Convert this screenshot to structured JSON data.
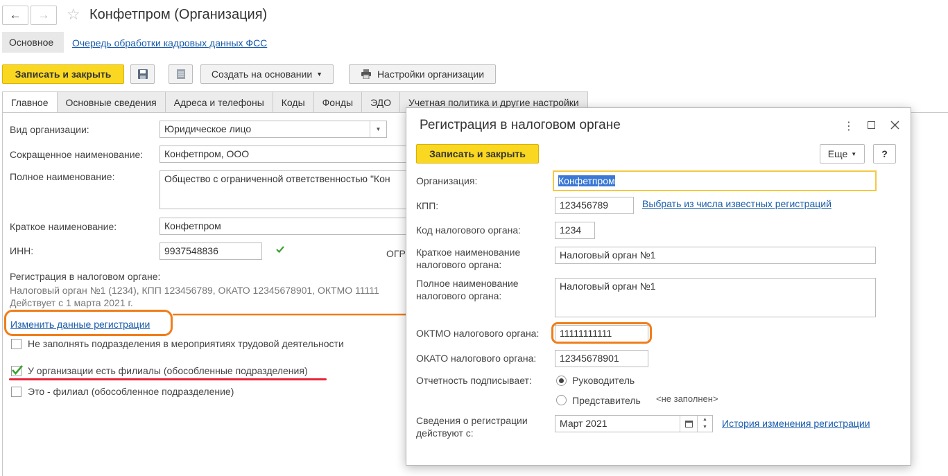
{
  "window": {
    "title": "Конфетпром (Организация)",
    "back_icon": "←",
    "forward_icon": "→",
    "star_icon": "☆"
  },
  "section_tabs": {
    "main": "Основное",
    "queue_link": "Очередь обработки кадровых данных ФСС"
  },
  "toolbar": {
    "save_close": "Записать и закрыть",
    "create_based": "Создать на основании",
    "settings": "Настройки организации"
  },
  "tabs": [
    "Главное",
    "Основные сведения",
    "Адреса и телефоны",
    "Коды",
    "Фонды",
    "ЭДО",
    "Учетная политика и другие настройки"
  ],
  "form": {
    "org_type_label": "Вид организации:",
    "org_type_value": "Юридическое лицо",
    "short_name_label": "Сокращенное наименование:",
    "short_name_value": "Конфетпром, ООО",
    "full_name_label": "Полное наименование:",
    "full_name_value": "Общество с ограниченной ответственностью \"Кон",
    "brief_name_label": "Краткое наименование:",
    "brief_name_value": "Конфетпром",
    "inn_label": "ИНН:",
    "inn_value": "9937548836",
    "ogrn_label": "ОГР",
    "reg_label": "Регистрация в налоговом органе:",
    "reg_info": "Налоговый орган №1 (1234), КПП 123456789, ОКАТО 12345678901, ОКТМО 11111",
    "reg_valid": "Действует с 1 марта 2021 г.",
    "change_reg_link": "Изменить данные регистрации",
    "chk_no_fill": "Не заполнять подразделения в мероприятиях трудовой деятельности",
    "chk_branches": "У организации есть филиалы (обособленные подразделения)",
    "chk_is_branch": "Это - филиал (обособленное подразделение)"
  },
  "dialog": {
    "title": "Регистрация в налоговом органе",
    "save_close": "Записать и закрыть",
    "more": "Еще",
    "help": "?",
    "org_label": "Организация:",
    "org_value": "Конфетпром",
    "kpp_label": "КПП:",
    "kpp_value": "123456789",
    "kpp_link": "Выбрать из числа известных регистраций",
    "code_label": "Код налогового органа:",
    "code_value": "1234",
    "brief_label_1": "Краткое наименование",
    "brief_label_2": "налогового органа:",
    "brief_value": "Налоговый орган №1",
    "full_label_1": "Полное наименование",
    "full_label_2": "налогового органа:",
    "full_value": "Налоговый орган №1",
    "oktmo_label": "ОКТМО налогового органа:",
    "oktmo_value": "11111111111",
    "okato_label": "ОКАТО налогового органа:",
    "okato_value": "12345678901",
    "signer_label": "Отчетность подписывает:",
    "signer_head": "Руководитель",
    "signer_rep": "Представитель",
    "signer_rep_value": "<не заполнен>",
    "valid_label_1": "Сведения о регистрации",
    "valid_label_2": "действуют с:",
    "valid_value": "Март 2021",
    "history_link": "История изменения регистрации"
  },
  "colors": {
    "accent_yellow": "#fad720",
    "link_blue": "#1a5dab",
    "annotation_orange": "#f07d1a",
    "annotation_red": "#e8243a",
    "check_green": "#3aa030"
  }
}
